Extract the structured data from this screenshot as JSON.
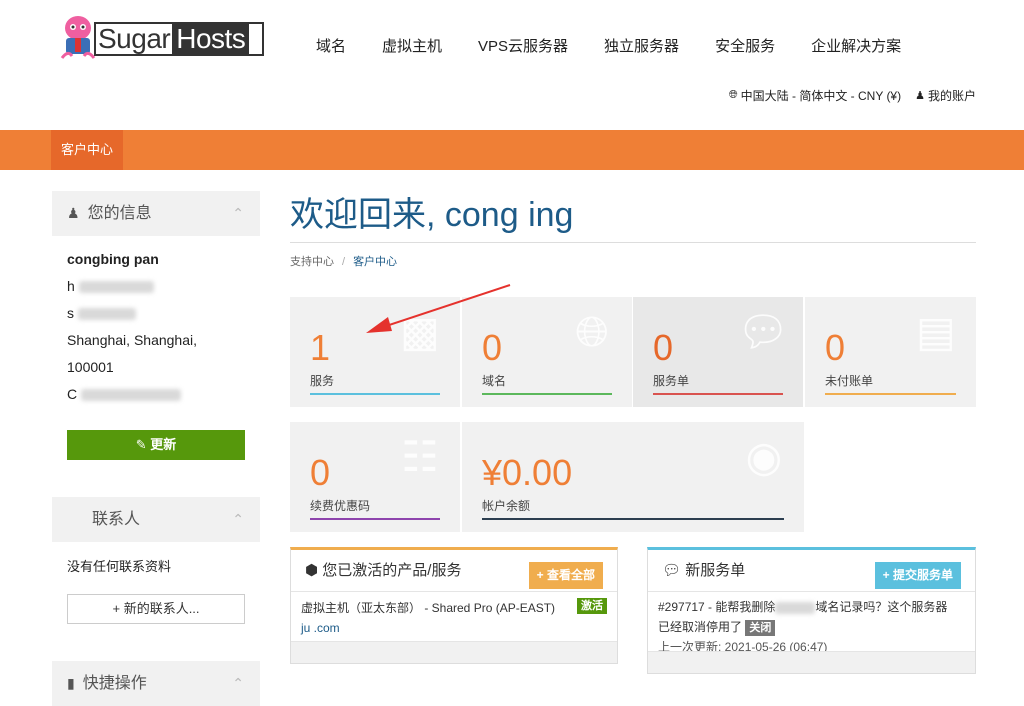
{
  "logo": {
    "part1": "Sugar",
    "part2": "Hosts"
  },
  "nav": [
    "域名",
    "虚拟主机",
    "VPS云服务器",
    "独立服务器",
    "安全服务",
    "企业解决方案"
  ],
  "util": {
    "locale": "中国大陆 - 简体中文 - CNY (¥)",
    "account": "我的账户"
  },
  "breadcrumb_bar": {
    "label": "客户中心"
  },
  "sidebar": {
    "info": {
      "title": "您的信息",
      "name": "congbing pan",
      "line2": "h",
      "line3": "s",
      "line4": "Shanghai, Shanghai,",
      "line5": "100001",
      "line6": "C",
      "update_label": "更新"
    },
    "contacts": {
      "title": "联系人",
      "empty": "没有任何联系资料",
      "new_label": "新的联系人..."
    },
    "shortcuts": {
      "title": "快捷操作"
    }
  },
  "main": {
    "title": "欢迎回来, cong  ing",
    "breadcrumb": {
      "home": "支持中心",
      "sep": "/",
      "current": "客户中心"
    }
  },
  "tiles": [
    {
      "value": "1",
      "label": "服务",
      "color": "#5bc0de"
    },
    {
      "value": "0",
      "label": "域名",
      "color": "#5cb85c"
    },
    {
      "value": "0",
      "label": "服务单",
      "color": "#d9534f"
    },
    {
      "value": "0",
      "label": "未付账单",
      "color": "#f0ad4e"
    },
    {
      "value": "0",
      "label": "续费优惠码",
      "color": "#8e44ad"
    },
    {
      "value": "¥0.00",
      "label": "帐户余额",
      "color": "#2c3e50"
    }
  ],
  "products_card": {
    "title": "您已激活的产品/服务",
    "button": "查看全部",
    "item": "虚拟主机（亚太东部） - Shared Pro (AP-EAST)",
    "status": "激活",
    "domain": "ju        .com"
  },
  "tickets_card": {
    "title": "新服务单",
    "button": "提交服务单",
    "ticket": "#297717 - 能帮我删除",
    "ticket_rest": "域名记录吗？这个服务器",
    "ticket_line2": "已经取消停用了",
    "status": "关闭",
    "updated": "上一次更新: 2021-05-26 (06:47)"
  },
  "colors": {
    "accent": "#ef7f36",
    "brand_blue": "#1d5b88",
    "green": "#56980c"
  }
}
